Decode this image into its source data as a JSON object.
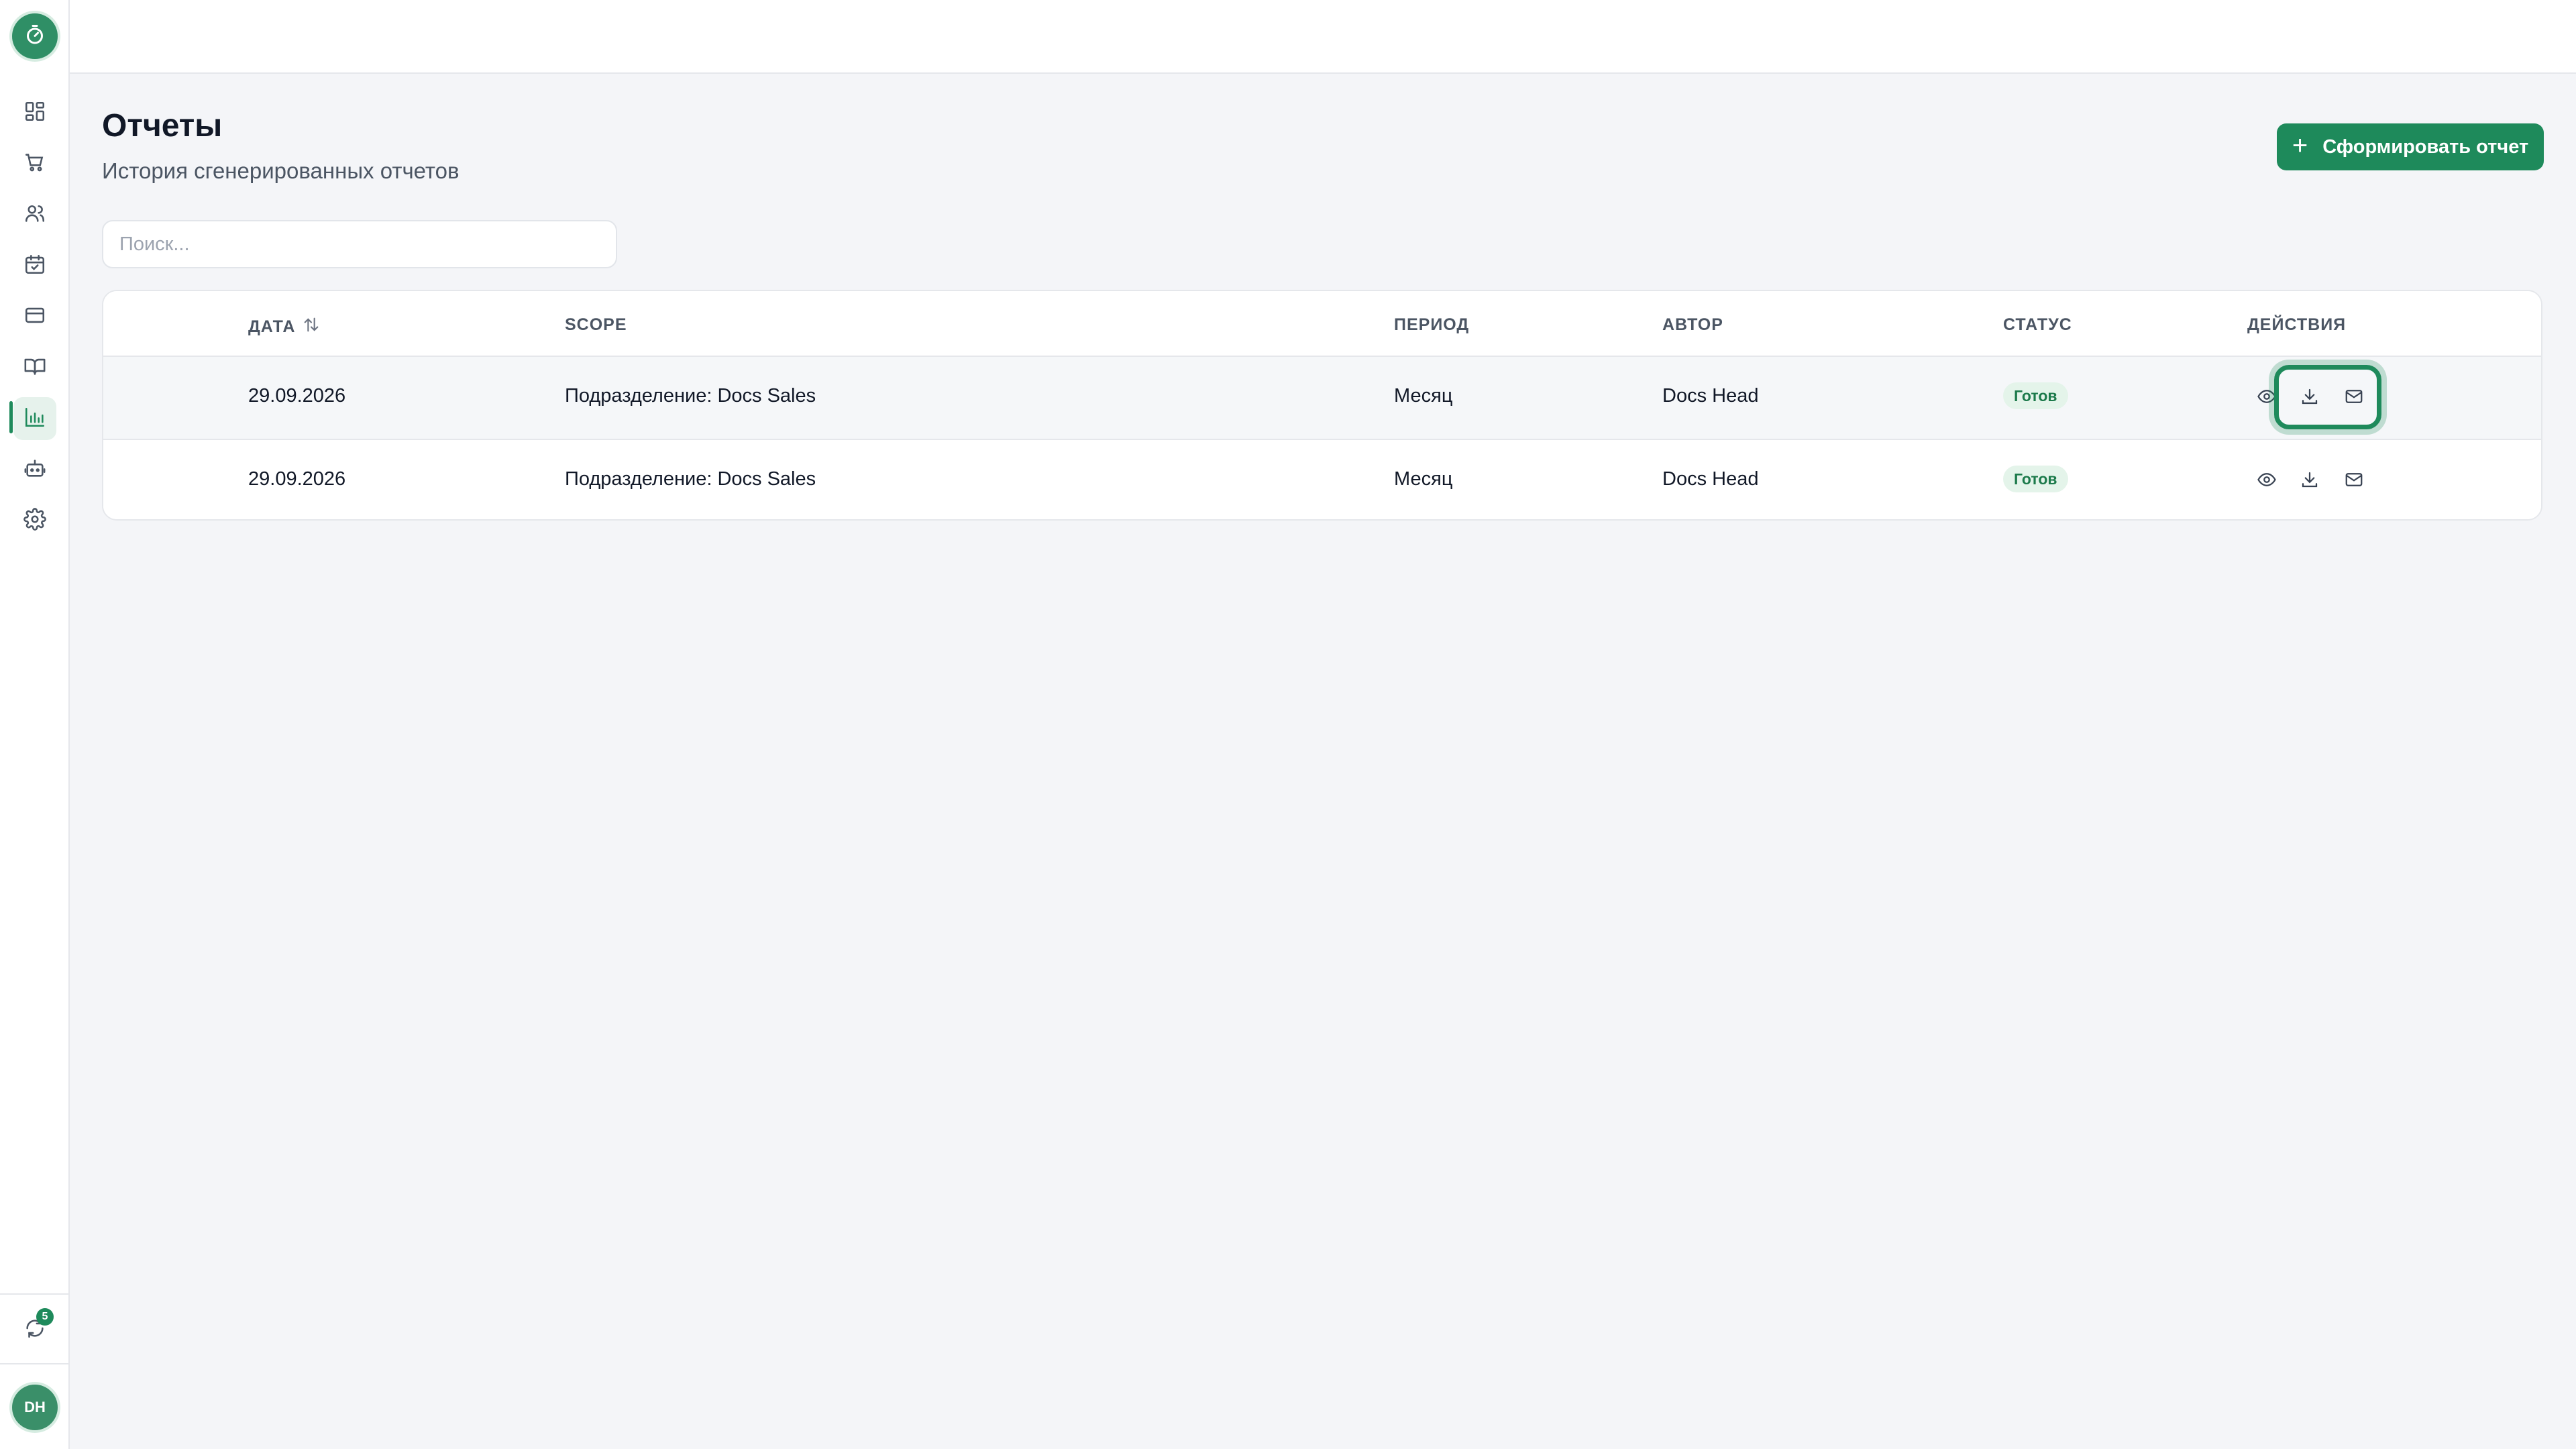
{
  "app": {
    "logo_icon": "stopwatch-icon",
    "accent_color": "#1e8a5b"
  },
  "sidebar": {
    "items": [
      {
        "name": "dashboard",
        "icon": "dashboard-icon",
        "active": false
      },
      {
        "name": "orders",
        "icon": "cart-icon",
        "active": false
      },
      {
        "name": "users",
        "icon": "users-icon",
        "active": false
      },
      {
        "name": "calendar",
        "icon": "calendar-icon",
        "active": false
      },
      {
        "name": "payments",
        "icon": "card-icon",
        "active": false
      },
      {
        "name": "knowledge-base",
        "icon": "book-icon",
        "active": false
      },
      {
        "name": "reports",
        "icon": "bar-chart-icon",
        "active": true
      },
      {
        "name": "bots",
        "icon": "robot-icon",
        "active": false
      },
      {
        "name": "settings",
        "icon": "gear-icon",
        "active": false
      }
    ],
    "sync_badge": "5",
    "avatar_initials": "DH"
  },
  "header": {
    "title": "Отчеты",
    "subtitle": "История сгенерированных отчетов",
    "create_button": "Сформировать отчет"
  },
  "search": {
    "placeholder": "Поиск...",
    "value": ""
  },
  "table": {
    "columns": {
      "date": "ДАТА",
      "scope": "SCOPE",
      "period": "ПЕРИОД",
      "author": "АВТОР",
      "status": "СТАТУС",
      "actions": "ДЕЙСТВИЯ"
    },
    "rows": [
      {
        "date": "29.09.2026",
        "scope": "Подразделение: Docs Sales",
        "period": "Месяц",
        "author": "Docs Head",
        "status": "Готов"
      },
      {
        "date": "29.09.2026",
        "scope": "Подразделение: Docs Sales",
        "period": "Месяц",
        "author": "Docs Head",
        "status": "Готов"
      }
    ]
  }
}
